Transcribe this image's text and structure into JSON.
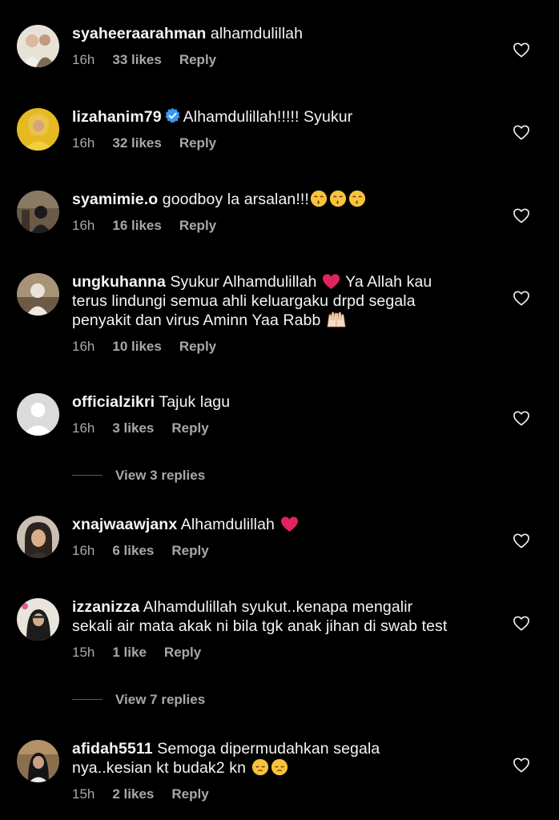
{
  "comments": [
    {
      "username": "syaheeraarahman",
      "text": "alhamdulillah",
      "time": "16h",
      "likes": "33 likes",
      "reply": "Reply",
      "avatar_color": "#c9b7a0"
    },
    {
      "username": "lizahanim79",
      "verified": true,
      "text": "Alhamdulillah!!!!! Syukur",
      "time": "16h",
      "likes": "32 likes",
      "reply": "Reply",
      "avatar_color": "#e0b21a"
    },
    {
      "username": "syamimie.o",
      "text": "goodboy la arsalan!!!",
      "emojis": [
        "kissing-face",
        "kissing-face",
        "kissing-face"
      ],
      "time": "16h",
      "likes": "16 likes",
      "reply": "Reply",
      "avatar_color": "#5a4a3a"
    },
    {
      "username": "ungkuhanna",
      "text_1": "Syukur Alhamdulillah",
      "text_2": "Ya Allah kau",
      "text_line2": "terus lindungi semua ahli keluargaku drpd segala",
      "text_line3": "penyakit dan virus Aminn Yaa Rabb",
      "emojis": [
        "red-heart",
        "praying-hands"
      ],
      "time": "16h",
      "likes": "10 likes",
      "reply": "Reply",
      "avatar_color": "#8c7a60"
    },
    {
      "username": "officialzikri",
      "text": "Tajuk lagu",
      "time": "16h",
      "likes": "3 likes",
      "reply": "Reply",
      "avatar_color": "#dbdbdb",
      "view_replies": "View 3 replies"
    },
    {
      "username": "xnajwaawjanx",
      "text": "Alhamdulillah",
      "emojis": [
        "red-heart"
      ],
      "time": "16h",
      "likes": "6 likes",
      "reply": "Reply",
      "avatar_color": "#3b2f2a"
    },
    {
      "username": "izzanizza",
      "text_line1": "Alhamdulillah syukut..kenapa mengalir",
      "text_line2": "sekali air mata akak ni bila tgk anak jihan di swab test",
      "time": "15h",
      "likes": "1 like",
      "reply": "Reply",
      "avatar_color": "#2a2a2a",
      "view_replies": "View 7 replies"
    },
    {
      "username": "afidah5511",
      "text_line1": "Semoga dipermudahkan segala",
      "text_line2": "nya..kesian kt budak2 kn",
      "emojis": [
        "pensive-face",
        "pensive-face"
      ],
      "time": "15h",
      "likes": "2 likes",
      "reply": "Reply",
      "avatar_color": "#4a3b2c"
    }
  ],
  "colors": {
    "background": "#000000",
    "text": "#f5f5f5",
    "meta": "#a8a8a8",
    "verified": "#3897f0",
    "heart_emoji": "#e0245e"
  },
  "icons": {
    "like": "heart-outline-icon",
    "verified": "verified-badge-icon"
  }
}
